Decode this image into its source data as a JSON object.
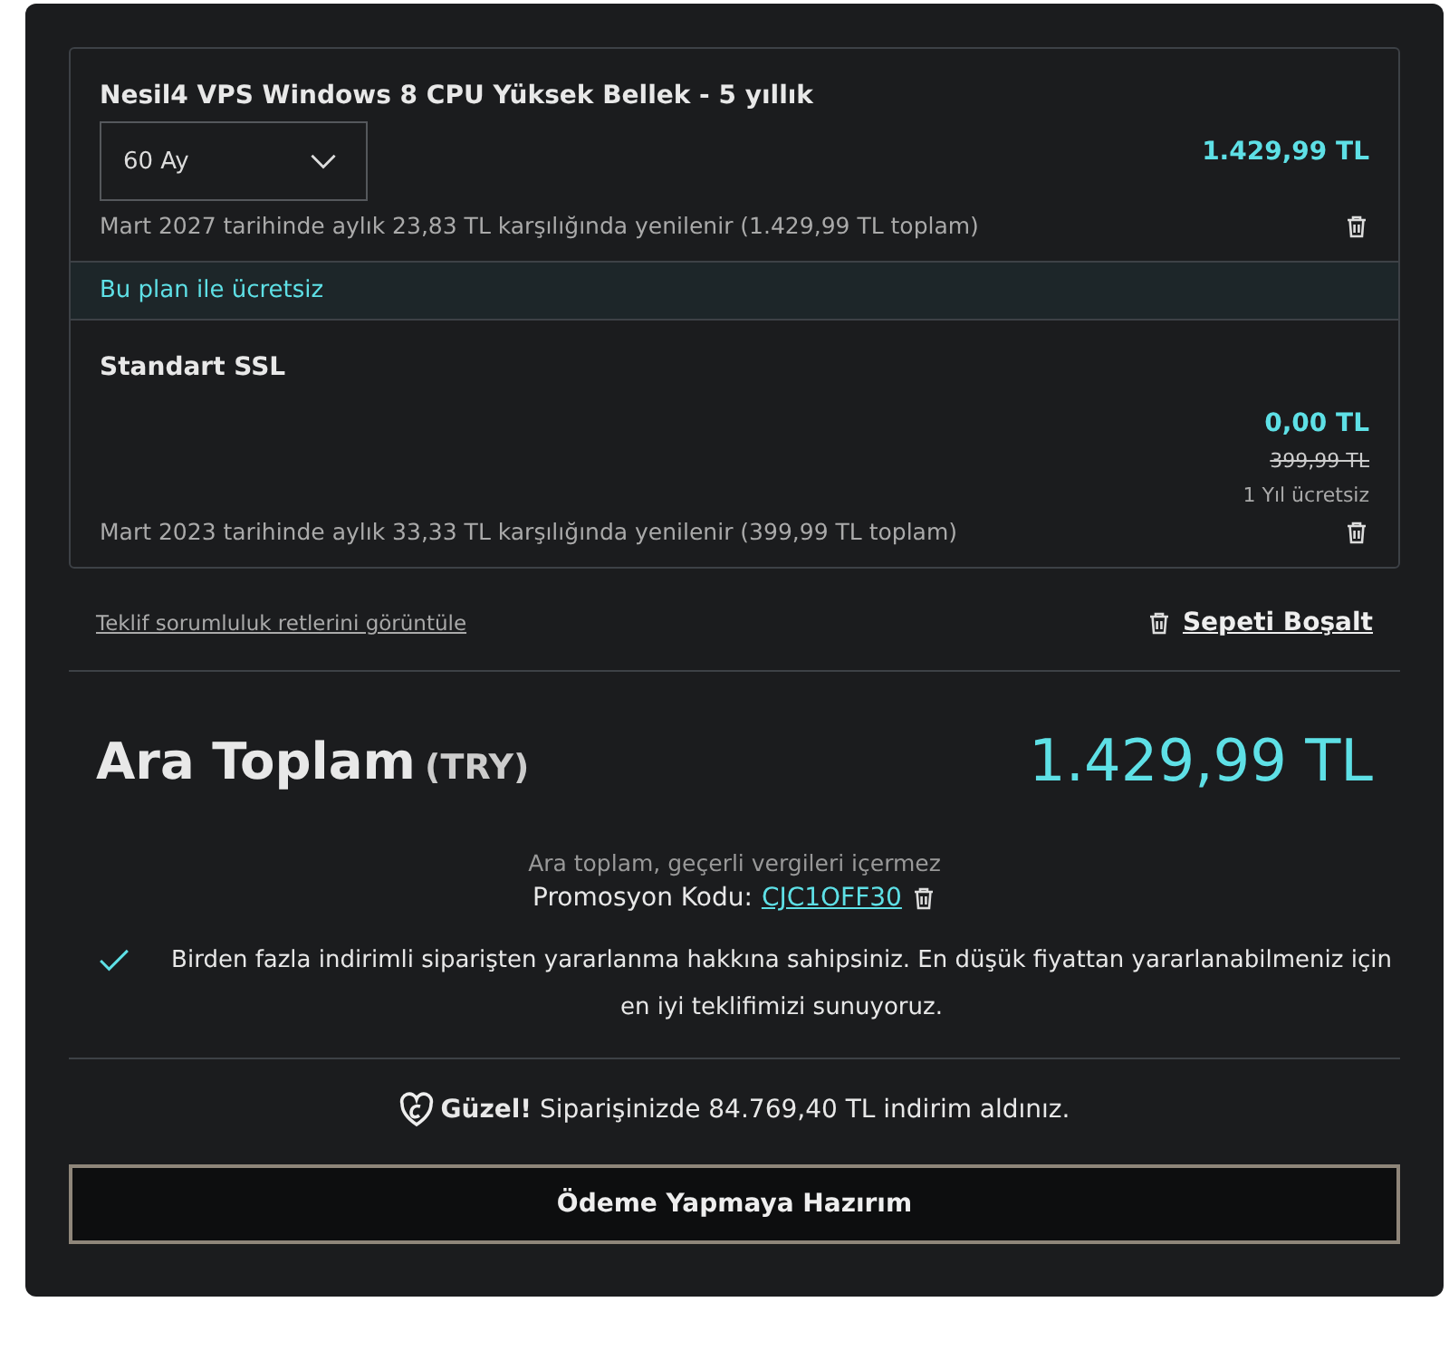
{
  "cart_items": [
    {
      "kind": "plan",
      "title": "Nesil4 VPS Windows 8 CPU Yüksek Bellek - 5 yıllık",
      "term": "60 Ay",
      "price": "1.429,99 TL",
      "renewal": "Mart 2027 tarihinde aylık 23,83 TL karşılığında yenilenir (1.429,99 TL toplam)"
    },
    {
      "kind": "banner",
      "text": "Bu plan ile ücretsiz"
    },
    {
      "kind": "addon",
      "title": "Standart SSL",
      "price": "0,00 TL",
      "original_price": "399,99 TL",
      "note": "1 Yıl ücretsiz",
      "renewal": "Mart 2023 tarihinde aylık 33,33 TL karşılığında yenilenir (399,99 TL toplam)"
    }
  ],
  "disclaimer_link": "Teklif sorumluluk retlerini görüntüle",
  "empty_cart": "Sepeti Boşalt",
  "subtotal": {
    "label": "Ara Toplam",
    "currency": "(TRY)",
    "amount": "1.429,99 TL",
    "tax_note": "Ara toplam, geçerli vergileri içermez",
    "promo_label": "Promosyon Kodu:",
    "promo_code": "CJC1OFF30"
  },
  "discount_notice": "Birden fazla indirimli siparişten yararlanma hakkına sahipsiniz. En düşük fiyattan yararlanabilmeniz için en iyi teklifimizi sunuyoruz.",
  "savings": "**Güzel!** Siparişinizde 84.769,40 TL indirim aldınız.",
  "checkout_button": "Ödeme Yapmaya Hazırım"
}
